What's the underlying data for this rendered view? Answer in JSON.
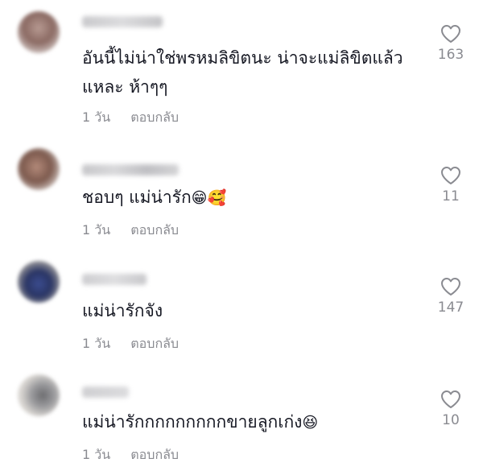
{
  "comments": [
    {
      "username": "",
      "text": "อันนี้ไม่น่าใช่พรหมลิขิตนะ น่าจะแม่ลิขิตแล้วแหละ ห้าๆๆ",
      "emoji": "",
      "time": "1 วัน",
      "reply_label": "ตอบกลับ",
      "likes": "163"
    },
    {
      "username": "",
      "text": "ชอบๆ แม่น่ารัก",
      "emoji": "😁🥰",
      "time": "1 วัน",
      "reply_label": "ตอบกลับ",
      "likes": "11"
    },
    {
      "username": "",
      "text": "แม่น่ารักจัง",
      "emoji": "",
      "time": "1 วัน",
      "reply_label": "ตอบกลับ",
      "likes": "147"
    },
    {
      "username": "",
      "text": "แม่น่ารักกกกกกกกกขายลูกเก่ง",
      "emoji": "😆",
      "time": "1 วัน",
      "reply_label": "ตอบกลับ",
      "likes": "10"
    }
  ],
  "colors": {
    "text": "#161823",
    "muted": "#8a8b91",
    "heart": "#8a8b91",
    "background": "#ffffff"
  },
  "icons": {
    "like": "heart-outline-icon"
  }
}
